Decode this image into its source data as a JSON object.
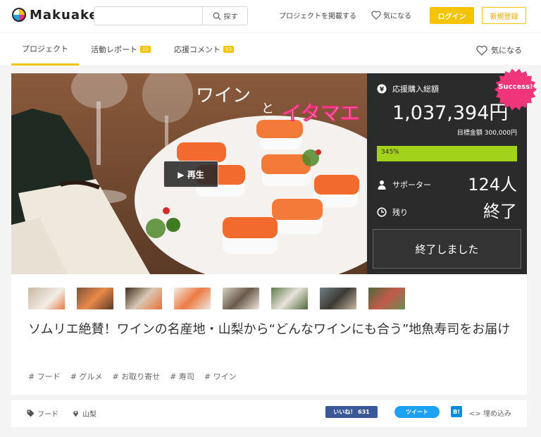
{
  "brand": {
    "name": "Makuake"
  },
  "header": {
    "search": {
      "placeholder": "",
      "button_label": "探す"
    },
    "post_project": "プロジェクトを掲載する",
    "favorites": "気になる",
    "login": "ログイン",
    "register": "新規登録"
  },
  "tabs": [
    {
      "label": "プロジェクト",
      "badge": ""
    },
    {
      "label": "活動レポート",
      "badge": "23"
    },
    {
      "label": "応援コメント",
      "badge": "53"
    }
  ],
  "tab_favorite": "気になる",
  "hero": {
    "overlay_text_1": "ワイン",
    "overlay_text_2": "と",
    "overlay_text_3": "イタマエ",
    "play_label": "▶ 再生"
  },
  "stats": {
    "amount_label": "応援購入総額",
    "amount": "1,037,394円",
    "goal": "目標金額 300,000円",
    "progress_label": "345%",
    "progress_fraction": 1.0,
    "supporters_label": "サポーター",
    "supporters": "124人",
    "remaining_label": "残り",
    "remaining": "終了",
    "ended_button": "終了しました",
    "success_badge": "Success!"
  },
  "thumb_count": 8,
  "project": {
    "title": "ソムリエ絶賛！ワインの名産地・山梨から“どんなワインにも合う”地魚寿司をお届け",
    "tags": [
      "# フード",
      "# グルメ",
      "# お取り寄せ",
      "# 寿司",
      "# ワイン"
    ]
  },
  "footer": {
    "category": "フード",
    "location": "山梨",
    "fb_label": "いいね！ 631",
    "tw_label": "ツイート",
    "hb_label": "B!",
    "embed_label": "<> 埋め込み"
  },
  "colors": {
    "accent": "#f5c400",
    "progress": "#a2d21a",
    "success": "#f0357a",
    "panel": "#2b2b2b"
  }
}
